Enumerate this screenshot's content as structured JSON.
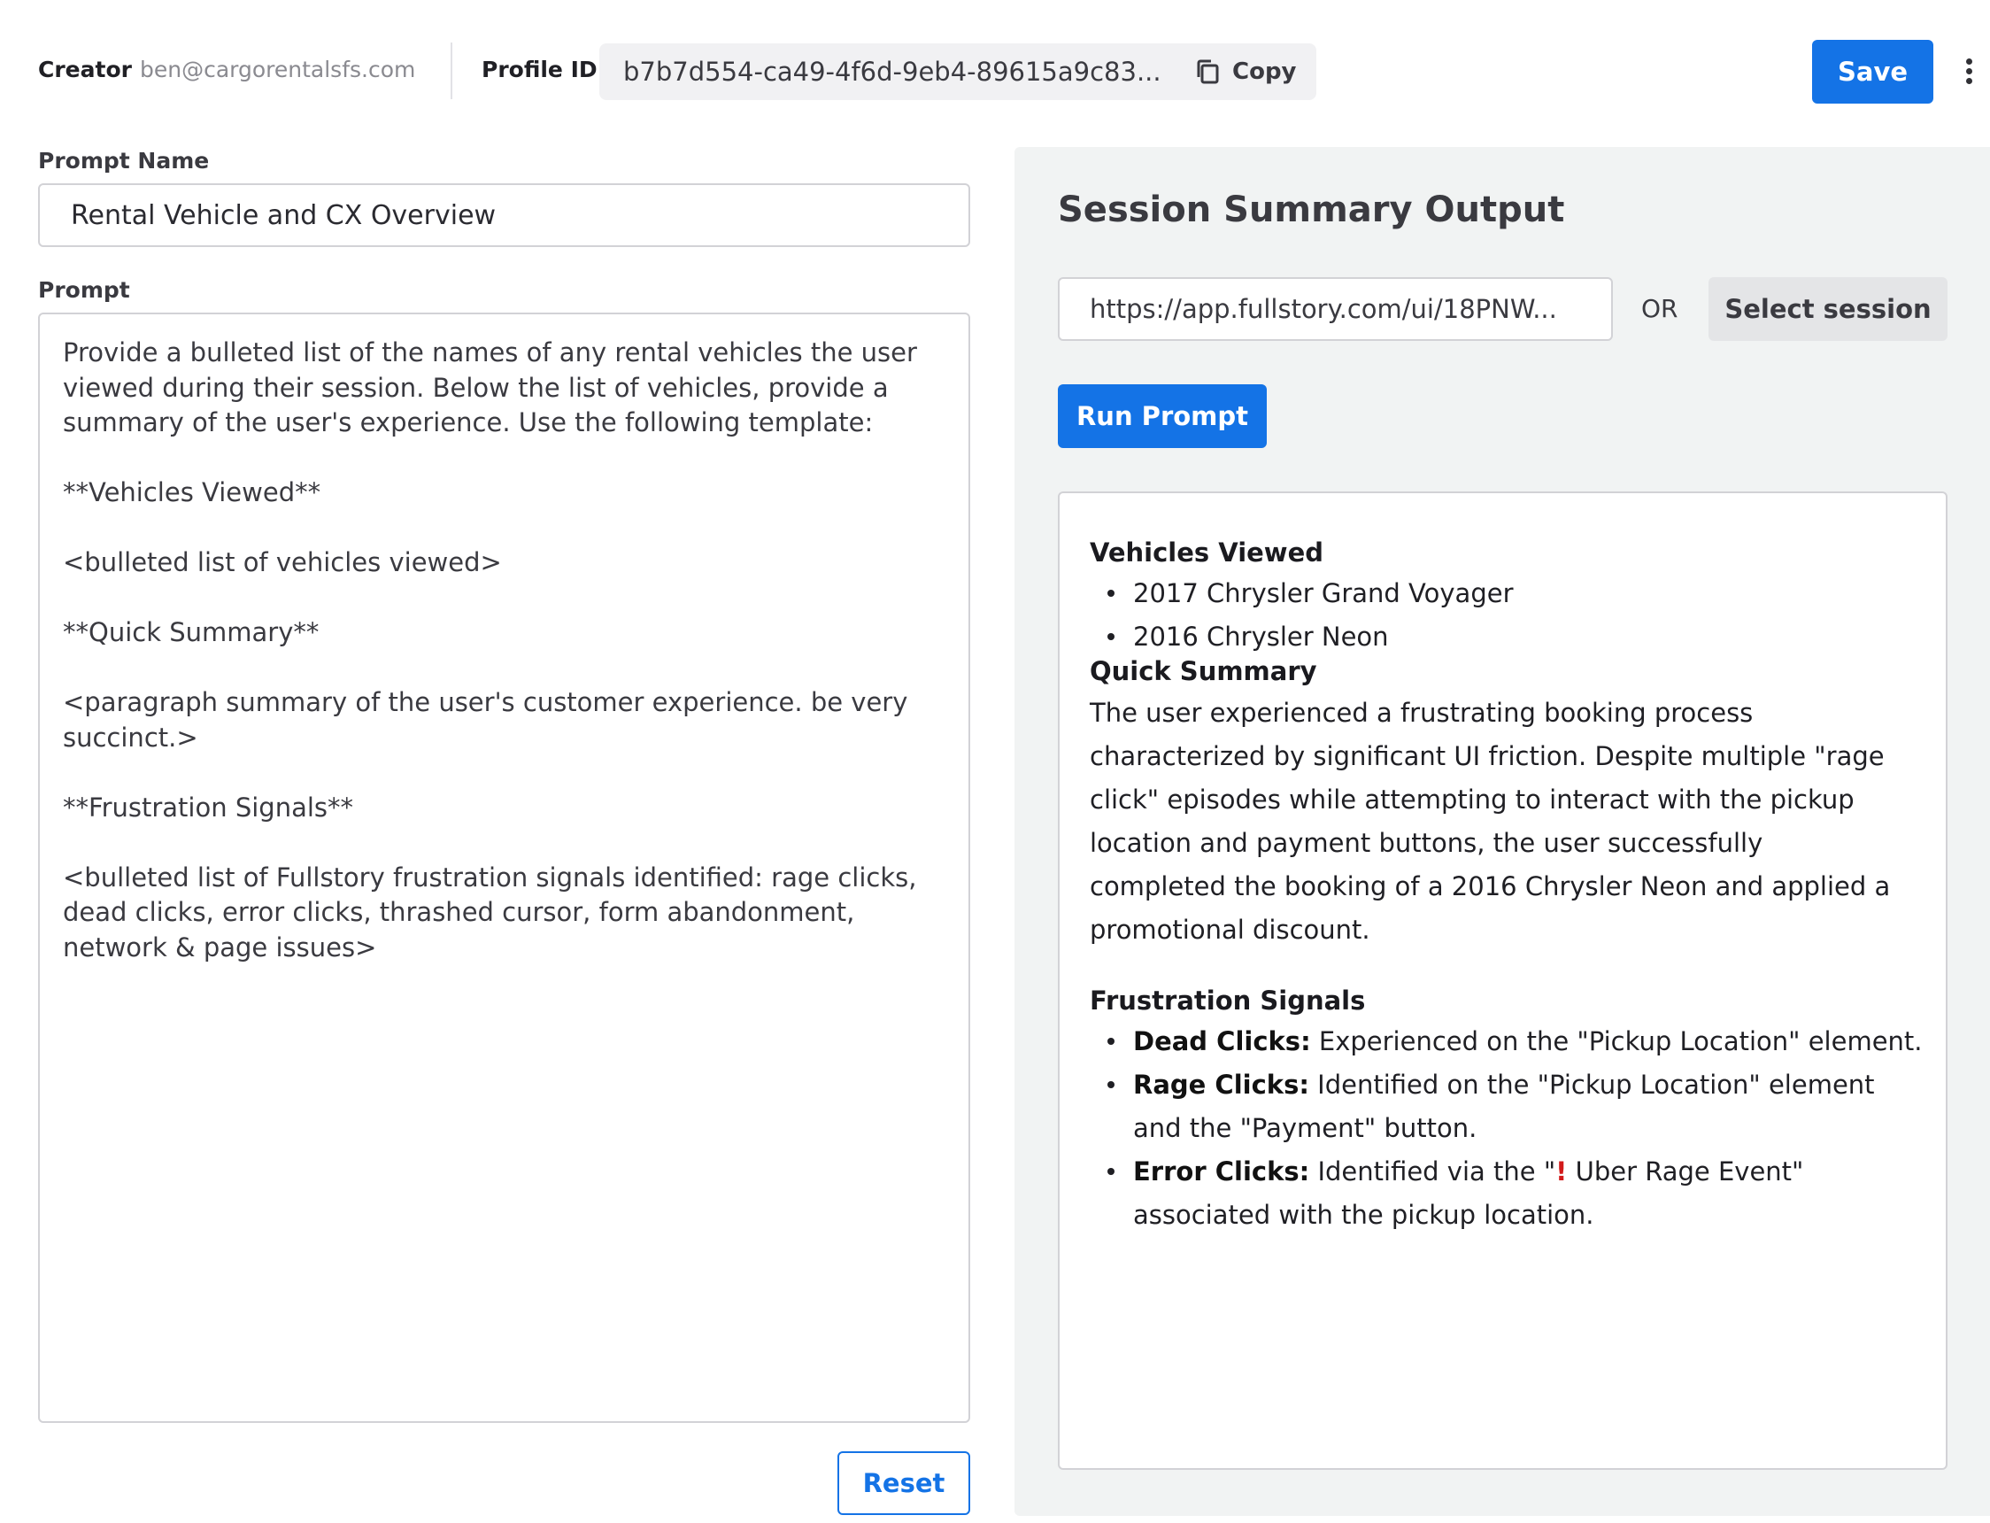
{
  "header": {
    "creator_label": "Creator",
    "creator_email": "ben@cargorentalsfs.com",
    "profile_label": "Profile ID",
    "profile_id": "b7b7d554-ca49-4f6d-9eb4-89615a9c83...",
    "copy_label": "Copy",
    "save_label": "Save",
    "more_icon": "kebab-menu-icon"
  },
  "left": {
    "prompt_name_label": "Prompt Name",
    "prompt_name_value": "Rental Vehicle and CX Overview",
    "prompt_label": "Prompt",
    "prompt_text": "Provide a bulleted list of the names of any rental vehicles the user viewed during their session. Below the list of vehicles, provide a summary of the user's experience. Use the following template:\n\n**Vehicles Viewed**\n\n<bulleted list of vehicles viewed>\n\n**Quick Summary**\n\n<paragraph summary of the user's customer experience. be very succinct.>\n\n**Frustration Signals**\n\n<bulleted list of Fullstory frustration signals identified: rage clicks, dead clicks, error clicks, thrashed cursor, form abandonment, network & page issues>",
    "reset_label": "Reset"
  },
  "right": {
    "title": "Session Summary Output",
    "url_value": "https://app.fullstory.com/ui/18PNW...",
    "or_label": "OR",
    "select_session_label": "Select session",
    "run_prompt_label": "Run Prompt",
    "output": {
      "vehicles_heading": "Vehicles Viewed",
      "vehicles": [
        "2017 Chrysler Grand Voyager",
        "2016 Chrysler Neon"
      ],
      "summary_heading": "Quick Summary",
      "summary_lines": [
        "The user experienced a frustrating booking process",
        "characterized by significant UI friction. Despite multiple \"rage",
        "click\" episodes while attempting to interact with the pickup",
        "location and payment buttons, the user successfully",
        "completed the booking of a 2016 Chrysler Neon and applied a",
        "promotional discount."
      ],
      "signals_heading": "Frustration Signals",
      "signals": [
        {
          "label": "Dead Clicks:",
          "lines": [
            "Experienced on the \"Pickup Location\" element."
          ]
        },
        {
          "label": "Rage Clicks:",
          "lines": [
            "Identified on the \"Pickup Location\" element",
            "and the \"Payment\" button."
          ]
        },
        {
          "label": "Error Clicks:",
          "pre": "Identified via the \"",
          "mark": "!",
          "post": " Uber Rage Event\"",
          "lines_after": [
            "associated with the pickup location."
          ]
        }
      ]
    }
  },
  "colors": {
    "accent": "#1473e6",
    "panel_bg": "#f1f3f3",
    "error_red": "#d21a1a"
  }
}
